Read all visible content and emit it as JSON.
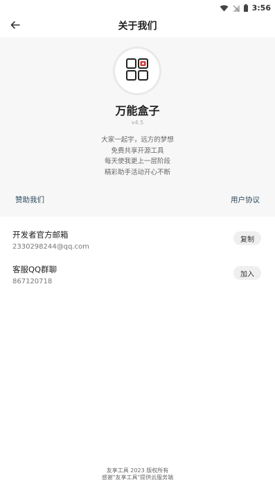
{
  "status_bar": {
    "time": "3:56",
    "icons": [
      "wifi-icon",
      "signal-off-icon",
      "battery-icon"
    ]
  },
  "appbar": {
    "back_icon": "arrow-left-icon",
    "title": "关于我们"
  },
  "about": {
    "logo_icon": "grid-box-icon",
    "app_name": "万能盒子",
    "version": "v4.5",
    "slogan": [
      "大家一起宇，远方的梦想",
      "免费共享开源工具",
      "每天使我更上一层阶段",
      "精彩助手活动开心不断"
    ],
    "sponsor_label": "赞助我们",
    "agreement_label": "用户协议"
  },
  "contacts": [
    {
      "title": "开发者官方邮箱",
      "value": "2330298244@qq.com",
      "action": "复制"
    },
    {
      "title": "客服QQ群聊",
      "value": "867120718",
      "action": "加入"
    }
  ],
  "footer": {
    "lines": [
      "友享工具  2023  版权所有",
      "感谢\"友享工具\"提供云服务端"
    ]
  },
  "colors": {
    "accent_link": "#2c4a5e",
    "logo_accent": "#d23a3a",
    "hero_bg": "#f7f7f7"
  }
}
